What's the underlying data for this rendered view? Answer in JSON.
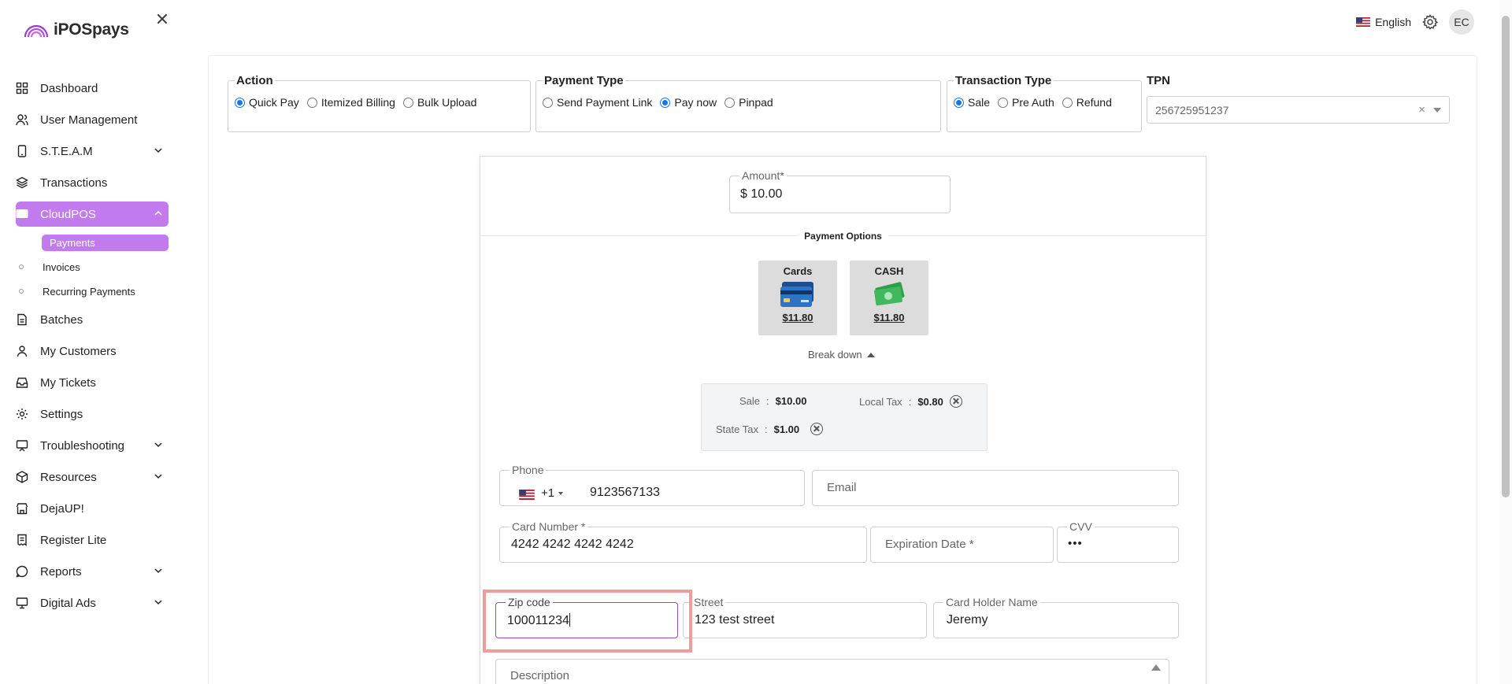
{
  "app": {
    "brand": "iPOSpays"
  },
  "header": {
    "language": "English",
    "avatar_initials": "EC"
  },
  "sidebar": {
    "items": [
      {
        "label": "Dashboard"
      },
      {
        "label": "User Management"
      },
      {
        "label": "S.T.E.A.M"
      },
      {
        "label": "Transactions"
      },
      {
        "label": "CloudPOS"
      },
      {
        "label": "Batches"
      },
      {
        "label": "My Customers"
      },
      {
        "label": "My Tickets"
      },
      {
        "label": "Settings"
      },
      {
        "label": "Troubleshooting"
      },
      {
        "label": "Resources"
      },
      {
        "label": "DejaUP!"
      },
      {
        "label": "Register Lite"
      },
      {
        "label": "Reports"
      },
      {
        "label": "Digital Ads"
      }
    ],
    "cloudpos_sub": [
      {
        "label": "Payments"
      },
      {
        "label": "Invoices"
      },
      {
        "label": "Recurring Payments"
      }
    ]
  },
  "action_group": {
    "legend": "Action",
    "options": [
      "Quick Pay",
      "Itemized Billing",
      "Bulk Upload"
    ],
    "selected": "Quick Pay"
  },
  "payment_type_group": {
    "legend": "Payment Type",
    "options": [
      "Send Payment Link",
      "Pay now",
      "Pinpad"
    ],
    "selected": "Pay now"
  },
  "transaction_type_group": {
    "legend": "Transaction Type",
    "options": [
      "Sale",
      "Pre Auth",
      "Refund"
    ],
    "selected": "Sale"
  },
  "tpn": {
    "label": "TPN",
    "value": "256725951237",
    "clear_glyph": "×"
  },
  "amount": {
    "label": "Amount*",
    "value": "$ 10.00"
  },
  "payment_options": {
    "title": "Payment Options",
    "cards": {
      "label": "Cards",
      "price": "$11.80"
    },
    "cash": {
      "label": "CASH",
      "price": "$11.80"
    }
  },
  "breakdown": {
    "toggle_label": "Break down",
    "sale_label": "Sale",
    "sale_value": "$10.00",
    "local_tax_label": "Local Tax",
    "local_tax_value": "$0.80",
    "state_tax_label": "State Tax",
    "state_tax_value": "$1.00",
    "separator": ":"
  },
  "form": {
    "phone_label": "Phone",
    "phone_code": "+1",
    "phone_value": "9123567133",
    "email_placeholder": "Email",
    "card_number_label": "Card Number *",
    "card_number_value": "4242 4242 4242 4242",
    "expiration_placeholder": "Expiration Date *",
    "cvv_label": "CVV",
    "cvv_value": "•••",
    "zip_label": "Zip code",
    "zip_value": "100011234",
    "street_label": "Street",
    "street_value": "123 test street",
    "holder_label": "Card Holder Name",
    "holder_value": "Jeremy",
    "description_placeholder": "Description"
  },
  "colors": {
    "accent": "#c27bef",
    "radio": "#1a73e8",
    "highlight": "#ee9d9a"
  }
}
